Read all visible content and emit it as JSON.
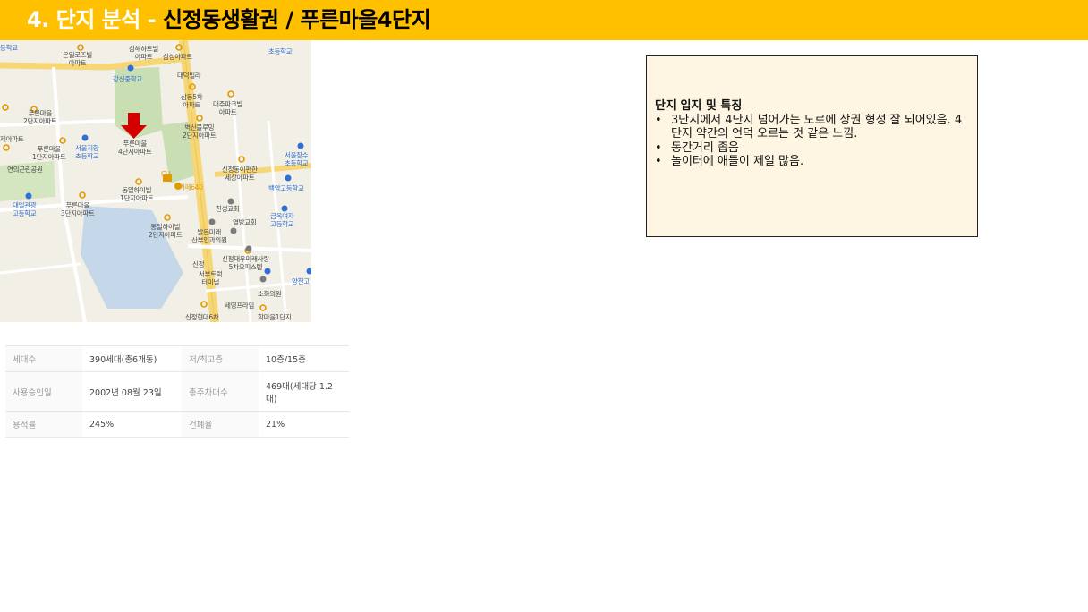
{
  "header": {
    "number": "4. 단지 분석 - ",
    "title": "신정동생활권 /  푸른마을4단지"
  },
  "colors": {
    "header_bg": "#ffc000",
    "note_bg": "#fef6e3",
    "marker": "#d40000",
    "map_green": "#c9dfb3",
    "map_water": "#c4d8ea",
    "map_road_major": "#f7d775"
  },
  "map": {
    "labels": [
      {
        "id": "lbl-1",
        "text": "은일로즈빌\n아파트",
        "kind": "normal"
      },
      {
        "id": "lbl-2",
        "text": "삼해하트빌\n아파트",
        "kind": "normal"
      },
      {
        "id": "lbl-3",
        "text": "삼성아파트",
        "kind": "normal"
      },
      {
        "id": "lbl-4",
        "text": "대덕빌라",
        "kind": "normal"
      },
      {
        "id": "lbl-5",
        "text": "강신중학교",
        "kind": "blue"
      },
      {
        "id": "lbl-6",
        "text": "삼동5차\n아파트",
        "kind": "normal"
      },
      {
        "id": "lbl-7",
        "text": "대주파크빌\n아파트",
        "kind": "normal"
      },
      {
        "id": "lbl-8",
        "text": "푸른마을\n2단지아파트",
        "kind": "normal"
      },
      {
        "id": "lbl-9",
        "text": "벽산블루밍\n2단지아파트",
        "kind": "normal"
      },
      {
        "id": "lbl-10",
        "text": "푸른마을\n4단지아파트",
        "kind": "normal"
      },
      {
        "id": "lbl-11",
        "text": "서울지향\n초등학교",
        "kind": "blue"
      },
      {
        "id": "lbl-12",
        "text": "푸른마을\n1단지아파트",
        "kind": "normal"
      },
      {
        "id": "lbl-13",
        "text": "제아파트",
        "kind": "normal"
      },
      {
        "id": "lbl-14",
        "text": "연의근린공원",
        "kind": "normal"
      },
      {
        "id": "lbl-15",
        "text": "신정동이편한\n세상아파트",
        "kind": "normal"
      },
      {
        "id": "lbl-16",
        "text": "서울장수\n초등학교",
        "kind": "blue"
      },
      {
        "id": "lbl-17",
        "text": "백암고등학교",
        "kind": "blue"
      },
      {
        "id": "lbl-18",
        "text": "동일하이빌\n1단지아파트",
        "kind": "normal"
      },
      {
        "id": "lbl-19",
        "text": "카페640",
        "kind": "orange"
      },
      {
        "id": "lbl-20",
        "text": "대일관광\n고등학교",
        "kind": "blue"
      },
      {
        "id": "lbl-21",
        "text": "푸른마을\n3단지아파트",
        "kind": "normal"
      },
      {
        "id": "lbl-22",
        "text": "한성교회",
        "kind": "normal"
      },
      {
        "id": "lbl-23",
        "text": "금옥여자\n고등학교",
        "kind": "blue"
      },
      {
        "id": "lbl-24",
        "text": "동일하이빌\n2단지아파트",
        "kind": "normal"
      },
      {
        "id": "lbl-25",
        "text": "열방교회",
        "kind": "normal"
      },
      {
        "id": "lbl-26",
        "text": "밝은미래\n산부인과의원",
        "kind": "normal"
      },
      {
        "id": "lbl-27",
        "text": "신정대우미래사랑\n5차오피스텔",
        "kind": "normal"
      },
      {
        "id": "lbl-28",
        "text": "신정",
        "kind": "normal"
      },
      {
        "id": "lbl-29",
        "text": "서부트럭\n터미널",
        "kind": "normal"
      },
      {
        "id": "lbl-30",
        "text": "양천고",
        "kind": "blue"
      },
      {
        "id": "lbl-31",
        "text": "소화의원",
        "kind": "normal"
      },
      {
        "id": "lbl-32",
        "text": "세영프라임",
        "kind": "normal"
      },
      {
        "id": "lbl-33",
        "text": "신정현대6차",
        "kind": "normal"
      },
      {
        "id": "lbl-34",
        "text": "학마을1단지",
        "kind": "normal"
      },
      {
        "id": "lbl-35",
        "text": "등학교",
        "kind": "blue"
      },
      {
        "id": "lbl-36",
        "text": "초등학교",
        "kind": "blue"
      },
      {
        "id": "lbl-37",
        "text": "CU",
        "kind": "orange"
      }
    ]
  },
  "stats": {
    "rows": [
      {
        "label1": "세대수",
        "value1": "390세대(총6개동)",
        "label2": "저/최고층",
        "value2": "10층/15층"
      },
      {
        "label1": "사용승인일",
        "value1": "2002년 08월 23일",
        "label2": "총주차대수",
        "value2": "469대(세대당 1.2대)"
      },
      {
        "label1": "용적률",
        "value1": "245%",
        "label2": "건폐율",
        "value2": "21%"
      }
    ]
  },
  "note": {
    "heading": "단지 입지 및 특징",
    "bullet_glyph": "•",
    "items": [
      "3단지에서 4단지 넘어가는 도로에 상권 형성 잘 되어있음. 4단지 약간의 언덕 오르는 것 같은 느낌.",
      "동간거리 좁음",
      "놀이터에 애들이 제일 많음."
    ]
  }
}
